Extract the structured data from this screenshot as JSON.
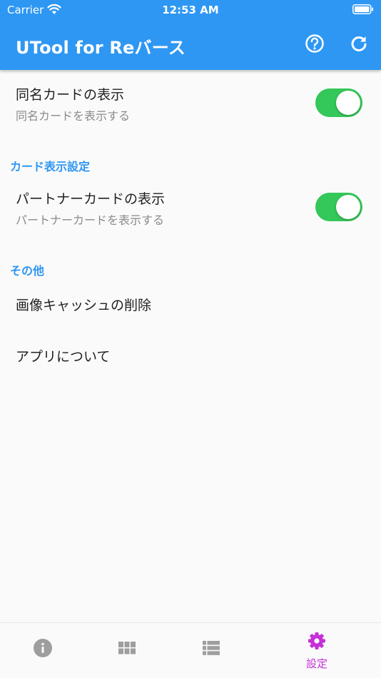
{
  "status_bar": {
    "carrier": "Carrier",
    "time": "12:53 AM"
  },
  "app_bar": {
    "title": "UTool for Reバース",
    "actions": [
      "help-icon",
      "refresh-icon"
    ]
  },
  "settings": {
    "same_name_card": {
      "title": "同名カードの表示",
      "subtitle": "同名カードを表示する",
      "enabled": true
    },
    "card_display_section": "カード表示設定",
    "partner_card": {
      "title": "パートナーカードの表示",
      "subtitle": "パートナーカードを表示する",
      "enabled": true
    },
    "other_section": "その他",
    "clear_image_cache": "画像キャッシュの削除",
    "about_app": "アプリについて"
  },
  "bottom_nav": {
    "items": [
      {
        "icon": "info-icon",
        "label": ""
      },
      {
        "icon": "grid-icon",
        "label": ""
      },
      {
        "icon": "list-icon",
        "label": ""
      },
      {
        "icon": "gear-icon",
        "label": "設定",
        "active": true
      }
    ]
  },
  "colors": {
    "primary": "#2e97f3",
    "toggle_on": "#34c759",
    "active_tab": "#c62fd9",
    "inactive_tab": "#9e9e9e"
  }
}
